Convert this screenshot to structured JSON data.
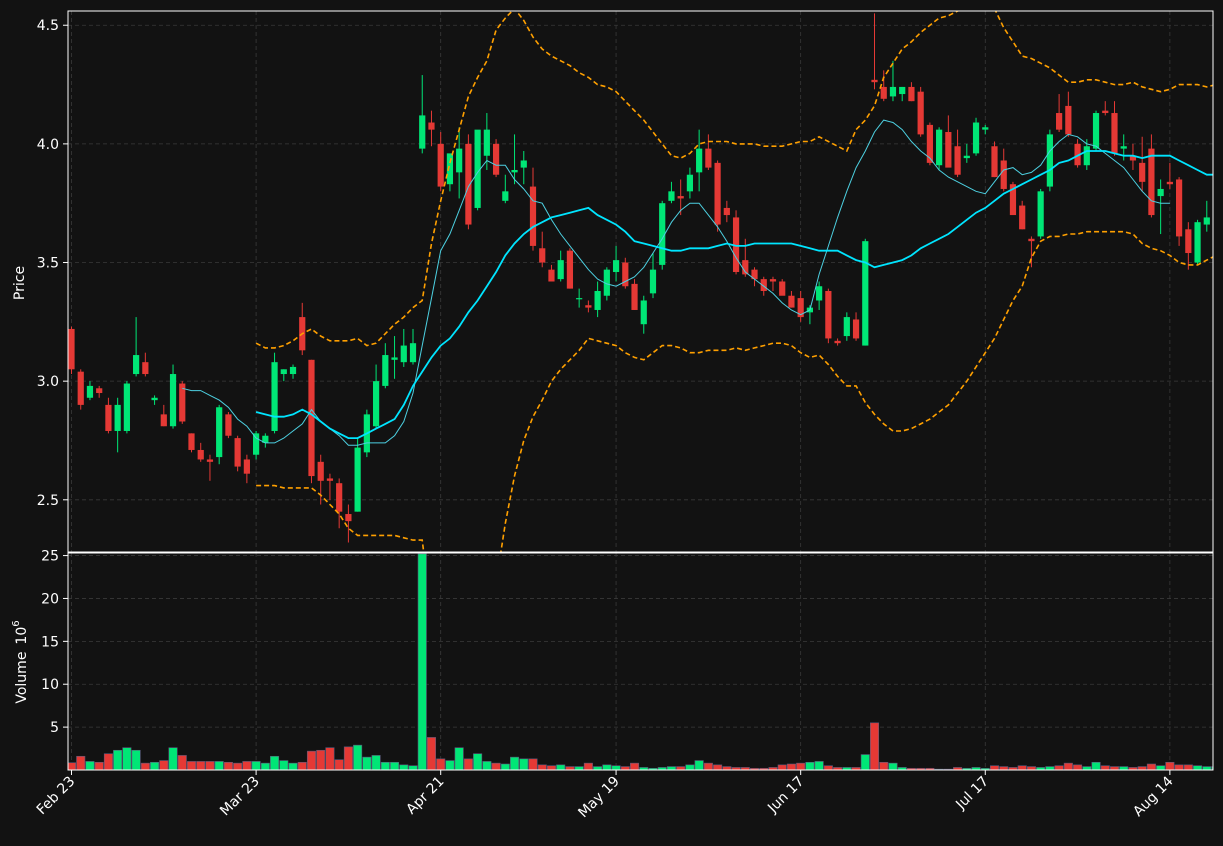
{
  "chart_data": {
    "type": "candlestick",
    "price_axis": {
      "label": "Price",
      "ylim": [
        2.28,
        4.56
      ],
      "ticks": [
        2.5,
        3.0,
        3.5,
        4.0,
        4.5
      ],
      "tick_labels": [
        "2.5",
        "3.0",
        "3.5",
        "4.0",
        "4.5"
      ]
    },
    "volume_axis": {
      "label": "Volume",
      "exponent_label": "10",
      "exponent": "6",
      "ylim": [
        0,
        25.3
      ],
      "ticks": [
        5,
        10,
        15,
        20,
        25
      ],
      "tick_labels": [
        "5",
        "10",
        "15",
        "20",
        "25"
      ]
    },
    "x_ticks": [
      {
        "index": 0,
        "label": "Feb 23"
      },
      {
        "index": 20,
        "label": "Mar 23"
      },
      {
        "index": 40,
        "label": "Apr 21"
      },
      {
        "index": 59,
        "label": "May 19"
      },
      {
        "index": 79,
        "label": "Jun 17"
      },
      {
        "index": 99,
        "label": "Jul 17"
      },
      {
        "index": 119,
        "label": "Aug 14"
      }
    ],
    "grid": true,
    "colors": {
      "up": "#00e676",
      "down": "#e53935",
      "background": "#121212",
      "grid": "#3a3a3a",
      "ma_short": "#4dd0e1",
      "ma_long": "#00e5ff",
      "bollinger": "#ffa000",
      "text": "#ffffff"
    },
    "candles": [
      [
        3.22,
        3.23,
        3.03,
        3.05,
        0.85
      ],
      [
        3.04,
        3.05,
        2.88,
        2.9,
        1.6
      ],
      [
        2.93,
        3.0,
        2.92,
        2.98,
        1.0
      ],
      [
        2.97,
        2.98,
        2.93,
        2.95,
        0.9
      ],
      [
        2.9,
        2.93,
        2.78,
        2.79,
        1.9
      ],
      [
        2.79,
        2.93,
        2.7,
        2.9,
        2.3
      ],
      [
        2.79,
        3.0,
        2.78,
        2.99,
        2.6
      ],
      [
        3.03,
        3.27,
        3.02,
        3.11,
        2.3
      ],
      [
        3.08,
        3.12,
        3.02,
        3.03,
        0.8
      ],
      [
        2.92,
        2.94,
        2.9,
        2.93,
        0.9
      ],
      [
        2.86,
        2.9,
        2.81,
        2.81,
        1.1
      ],
      [
        2.81,
        3.07,
        2.8,
        3.03,
        2.6
      ],
      [
        2.99,
        3.0,
        2.82,
        2.83,
        1.7
      ],
      [
        2.78,
        2.78,
        2.7,
        2.71,
        1.0
      ],
      [
        2.71,
        2.74,
        2.66,
        2.67,
        1.0
      ],
      [
        2.67,
        2.69,
        2.58,
        2.66,
        1.0
      ],
      [
        2.68,
        2.9,
        2.65,
        2.89,
        1.0
      ],
      [
        2.86,
        2.87,
        2.76,
        2.77,
        0.9
      ],
      [
        2.76,
        2.77,
        2.62,
        2.64,
        0.8
      ],
      [
        2.67,
        2.69,
        2.57,
        2.61,
        1.0
      ],
      [
        2.69,
        2.79,
        2.67,
        2.78,
        1.0
      ],
      [
        2.74,
        2.78,
        2.72,
        2.77,
        0.8
      ],
      [
        2.79,
        3.12,
        2.78,
        3.08,
        1.6
      ],
      [
        3.03,
        3.05,
        3.0,
        3.05,
        1.1
      ],
      [
        3.03,
        3.07,
        3.01,
        3.06,
        0.8
      ],
      [
        3.27,
        3.33,
        3.11,
        3.13,
        0.9
      ],
      [
        3.09,
        3.09,
        2.57,
        2.6,
        2.2
      ],
      [
        2.66,
        2.69,
        2.48,
        2.58,
        2.3
      ],
      [
        2.59,
        2.61,
        2.5,
        2.58,
        2.6
      ],
      [
        2.57,
        2.59,
        2.38,
        2.45,
        1.2
      ],
      [
        2.44,
        2.48,
        2.32,
        2.41,
        2.7
      ],
      [
        2.45,
        2.76,
        2.45,
        2.72,
        2.9
      ],
      [
        2.7,
        2.88,
        2.68,
        2.86,
        1.5
      ],
      [
        2.81,
        3.07,
        2.8,
        3.0,
        1.7
      ],
      [
        2.98,
        3.16,
        2.97,
        3.11,
        0.9
      ],
      [
        3.09,
        3.19,
        3.01,
        3.1,
        0.9
      ],
      [
        3.08,
        3.22,
        3.06,
        3.15,
        0.6
      ],
      [
        3.08,
        3.22,
        3.07,
        3.16,
        0.5
      ],
      [
        3.98,
        4.29,
        3.96,
        4.12,
        25.2
      ],
      [
        4.09,
        4.14,
        3.99,
        4.06,
        3.8
      ],
      [
        4.0,
        4.05,
        3.8,
        3.82,
        1.3
      ],
      [
        3.83,
        3.92,
        3.8,
        3.96,
        1.1
      ],
      [
        3.88,
        4.07,
        3.77,
        3.98,
        2.6
      ],
      [
        4.0,
        4.04,
        3.64,
        3.66,
        1.3
      ],
      [
        3.73,
        3.98,
        3.72,
        4.06,
        1.9
      ],
      [
        3.95,
        4.13,
        3.89,
        4.06,
        1.0
      ],
      [
        4.0,
        4.02,
        3.86,
        3.87,
        0.8
      ],
      [
        3.76,
        3.87,
        3.75,
        3.8,
        0.7
      ],
      [
        3.88,
        4.04,
        3.83,
        3.89,
        1.5
      ],
      [
        3.9,
        3.97,
        3.83,
        3.93,
        1.3
      ],
      [
        3.82,
        3.9,
        3.55,
        3.57,
        1.3
      ],
      [
        3.56,
        3.63,
        3.48,
        3.5,
        0.6
      ],
      [
        3.47,
        3.49,
        3.42,
        3.42,
        0.5
      ],
      [
        3.43,
        3.55,
        3.42,
        3.51,
        0.6
      ],
      [
        3.55,
        3.56,
        3.39,
        3.39,
        0.4
      ],
      [
        3.35,
        3.39,
        3.31,
        3.35,
        0.4
      ],
      [
        3.32,
        3.34,
        3.29,
        3.31,
        0.8
      ],
      [
        3.3,
        3.42,
        3.27,
        3.38,
        0.4
      ],
      [
        3.36,
        3.48,
        3.34,
        3.47,
        0.6
      ],
      [
        3.46,
        3.57,
        3.42,
        3.51,
        0.5
      ],
      [
        3.5,
        3.52,
        3.39,
        3.4,
        0.4
      ],
      [
        3.41,
        3.43,
        3.3,
        3.3,
        0.8
      ],
      [
        3.24,
        3.36,
        3.2,
        3.34,
        0.3
      ],
      [
        3.37,
        3.54,
        3.35,
        3.47,
        0.2
      ],
      [
        3.49,
        3.76,
        3.47,
        3.75,
        0.3
      ],
      [
        3.76,
        3.84,
        3.75,
        3.8,
        0.4
      ],
      [
        3.78,
        3.85,
        3.7,
        3.77,
        0.4
      ],
      [
        3.8,
        3.9,
        3.77,
        3.87,
        0.6
      ],
      [
        3.88,
        4.06,
        3.8,
        3.98,
        1.1
      ],
      [
        3.98,
        4.04,
        3.89,
        3.9,
        0.8
      ],
      [
        3.92,
        3.93,
        3.63,
        3.66,
        0.6
      ],
      [
        3.73,
        3.76,
        3.67,
        3.7,
        0.4
      ],
      [
        3.69,
        3.72,
        3.45,
        3.46,
        0.3
      ],
      [
        3.51,
        3.6,
        3.44,
        3.45,
        0.3
      ],
      [
        3.47,
        3.48,
        3.4,
        3.43,
        0.2
      ],
      [
        3.43,
        3.44,
        3.36,
        3.38,
        0.2
      ],
      [
        3.43,
        3.44,
        3.38,
        3.42,
        0.3
      ],
      [
        3.42,
        3.43,
        3.37,
        3.36,
        0.6
      ],
      [
        3.36,
        3.38,
        3.31,
        3.31,
        0.7
      ],
      [
        3.35,
        3.38,
        3.25,
        3.27,
        0.8
      ],
      [
        3.29,
        3.32,
        3.24,
        3.31,
        0.9
      ],
      [
        3.34,
        3.42,
        3.3,
        3.4,
        1.0
      ],
      [
        3.38,
        3.39,
        3.16,
        3.18,
        0.5
      ],
      [
        3.17,
        3.18,
        3.15,
        3.16,
        0.3
      ],
      [
        3.19,
        3.29,
        3.17,
        3.27,
        0.3
      ],
      [
        3.26,
        3.29,
        3.17,
        3.18,
        0.3
      ],
      [
        3.15,
        3.6,
        3.15,
        3.59,
        1.8
      ],
      [
        4.27,
        4.55,
        4.23,
        4.26,
        5.5
      ],
      [
        4.24,
        4.31,
        4.18,
        4.19,
        0.9
      ],
      [
        4.2,
        4.35,
        4.18,
        4.24,
        0.8
      ],
      [
        4.21,
        4.24,
        4.18,
        4.24,
        0.3
      ],
      [
        4.24,
        4.26,
        4.18,
        4.18,
        0.2
      ],
      [
        4.22,
        4.24,
        4.03,
        4.04,
        0.2
      ],
      [
        4.08,
        4.09,
        3.91,
        3.92,
        0.2
      ],
      [
        3.91,
        4.07,
        3.89,
        4.06,
        0.1
      ],
      [
        4.05,
        4.12,
        3.91,
        3.9,
        0.1
      ],
      [
        3.99,
        4.06,
        3.86,
        3.87,
        0.3
      ],
      [
        3.94,
        4.0,
        3.92,
        3.95,
        0.2
      ],
      [
        3.96,
        4.11,
        3.95,
        4.09,
        0.3
      ],
      [
        4.06,
        4.08,
        4.04,
        4.07,
        0.2
      ],
      [
        3.99,
        4.01,
        3.86,
        3.86,
        0.5
      ],
      [
        3.93,
        3.98,
        3.8,
        3.81,
        0.4
      ],
      [
        3.83,
        3.84,
        3.71,
        3.7,
        0.3
      ],
      [
        3.74,
        3.76,
        3.64,
        3.64,
        0.5
      ],
      [
        3.6,
        3.61,
        3.48,
        3.59,
        0.4
      ],
      [
        3.61,
        3.81,
        3.6,
        3.8,
        0.3
      ],
      [
        3.82,
        4.06,
        3.8,
        4.04,
        0.4
      ],
      [
        4.13,
        4.21,
        4.05,
        4.06,
        0.5
      ],
      [
        4.16,
        4.22,
        4.03,
        4.04,
        0.8
      ],
      [
        4.0,
        4.02,
        3.9,
        3.91,
        0.6
      ],
      [
        3.91,
        4.02,
        3.89,
        3.99,
        0.4
      ],
      [
        3.98,
        4.14,
        3.97,
        4.13,
        0.9
      ],
      [
        4.14,
        4.18,
        4.12,
        4.13,
        0.5
      ],
      [
        4.13,
        4.18,
        3.95,
        3.96,
        0.4
      ],
      [
        3.98,
        4.04,
        3.93,
        3.99,
        0.4
      ],
      [
        3.95,
        4.0,
        3.89,
        3.93,
        0.3
      ],
      [
        3.92,
        4.03,
        3.8,
        3.84,
        0.4
      ],
      [
        3.98,
        4.04,
        3.69,
        3.7,
        0.7
      ],
      [
        3.78,
        3.85,
        3.62,
        3.81,
        0.5
      ],
      [
        3.84,
        3.92,
        3.81,
        3.83,
        0.9
      ],
      [
        3.85,
        3.86,
        3.57,
        3.61,
        0.6
      ],
      [
        3.64,
        3.67,
        3.47,
        3.54,
        0.6
      ],
      [
        3.5,
        3.68,
        3.49,
        3.67,
        0.5
      ],
      [
        3.66,
        3.76,
        3.63,
        3.69,
        0.4
      ],
      [
        3.63,
        3.85,
        3.6,
        3.86,
        0.4
      ],
      [
        3.89,
        4.01,
        3.87,
        4.01,
        0.4
      ]
    ],
    "ma_short": [
      null,
      null,
      null,
      null,
      null,
      null,
      null,
      null,
      null,
      null,
      null,
      null,
      2.97,
      2.96,
      2.96,
      2.94,
      2.92,
      2.89,
      2.84,
      2.81,
      2.76,
      2.74,
      2.74,
      2.76,
      2.79,
      2.82,
      2.88,
      2.83,
      2.8,
      2.77,
      2.73,
      2.73,
      2.74,
      2.74,
      2.74,
      2.77,
      2.83,
      2.95,
      3.15,
      3.35,
      3.55,
      3.62,
      3.72,
      3.82,
      3.88,
      3.93,
      3.91,
      3.91,
      3.85,
      3.81,
      3.76,
      3.75,
      3.68,
      3.62,
      3.57,
      3.52,
      3.47,
      3.43,
      3.41,
      3.4,
      3.42,
      3.44,
      3.48,
      3.54,
      3.6,
      3.67,
      3.72,
      3.75,
      3.75,
      3.7,
      3.65,
      3.59,
      3.52,
      3.46,
      3.43,
      3.4,
      3.37,
      3.33,
      3.3,
      3.28,
      3.3,
      3.45,
      3.57,
      3.69,
      3.8,
      3.9,
      3.97,
      4.05,
      4.1,
      4.09,
      4.06,
      4.01,
      3.97,
      3.94,
      3.89,
      3.86,
      3.84,
      3.82,
      3.8,
      3.79,
      3.84,
      3.89,
      3.9,
      3.87,
      3.88,
      3.91,
      3.97,
      4.01,
      4.04,
      4.03,
      4.0,
      3.99,
      3.96,
      3.93,
      3.9,
      3.85,
      3.8,
      3.76,
      3.75,
      3.75,
      null,
      null
    ],
    "ma_long": [
      null,
      null,
      null,
      null,
      null,
      null,
      null,
      null,
      null,
      null,
      null,
      null,
      null,
      null,
      null,
      null,
      null,
      null,
      null,
      null,
      2.87,
      2.86,
      2.85,
      2.85,
      2.86,
      2.88,
      2.86,
      2.83,
      2.8,
      2.78,
      2.76,
      2.76,
      2.78,
      2.8,
      2.82,
      2.84,
      2.9,
      2.98,
      3.04,
      3.1,
      3.15,
      3.18,
      3.23,
      3.29,
      3.34,
      3.4,
      3.46,
      3.53,
      3.58,
      3.62,
      3.65,
      3.67,
      3.69,
      3.7,
      3.71,
      3.72,
      3.73,
      3.7,
      3.68,
      3.66,
      3.63,
      3.59,
      3.58,
      3.57,
      3.56,
      3.55,
      3.55,
      3.56,
      3.56,
      3.56,
      3.57,
      3.58,
      3.57,
      3.57,
      3.58,
      3.58,
      3.58,
      3.58,
      3.58,
      3.57,
      3.56,
      3.55,
      3.55,
      3.55,
      3.53,
      3.51,
      3.5,
      3.48,
      3.49,
      3.5,
      3.51,
      3.53,
      3.56,
      3.58,
      3.6,
      3.62,
      3.65,
      3.68,
      3.71,
      3.73,
      3.76,
      3.79,
      3.81,
      3.83,
      3.85,
      3.87,
      3.89,
      3.92,
      3.93,
      3.95,
      3.97,
      3.97,
      3.97,
      3.96,
      3.95,
      3.95,
      3.94,
      3.95,
      3.95,
      3.95,
      3.93,
      3.91,
      3.89,
      3.87,
      3.87,
      3.88,
      3.9
    ],
    "boll_upper": [
      null,
      null,
      null,
      null,
      null,
      null,
      null,
      null,
      null,
      null,
      null,
      null,
      null,
      null,
      null,
      null,
      null,
      null,
      null,
      null,
      3.16,
      3.14,
      3.14,
      3.15,
      3.17,
      3.2,
      3.22,
      3.19,
      3.17,
      3.17,
      3.17,
      3.18,
      3.15,
      3.16,
      3.2,
      3.24,
      3.27,
      3.31,
      3.34,
      3.58,
      3.76,
      3.92,
      4.06,
      4.2,
      4.28,
      4.35,
      4.48,
      4.53,
      4.57,
      4.52,
      4.45,
      4.4,
      4.37,
      4.35,
      4.33,
      4.3,
      4.28,
      4.25,
      4.24,
      4.22,
      4.18,
      4.14,
      4.1,
      4.05,
      4.0,
      3.95,
      3.94,
      3.96,
      4.0,
      4.01,
      4.01,
      4.01,
      4.0,
      4.0,
      4.0,
      3.99,
      3.99,
      3.99,
      4.0,
      4.01,
      4.01,
      4.03,
      4.01,
      3.99,
      3.97,
      4.06,
      4.1,
      4.16,
      4.28,
      4.34,
      4.4,
      4.43,
      4.47,
      4.5,
      4.53,
      4.54,
      4.56,
      4.57,
      4.6,
      4.62,
      4.57,
      4.49,
      4.43,
      4.37,
      4.36,
      4.34,
      4.32,
      4.29,
      4.26,
      4.26,
      4.27,
      4.27,
      4.26,
      4.25,
      4.25,
      4.26,
      4.24,
      4.23,
      4.22,
      4.23,
      4.25,
      4.25,
      4.25,
      4.24,
      4.25
    ],
    "boll_lower": [
      null,
      null,
      null,
      null,
      null,
      null,
      null,
      null,
      null,
      null,
      null,
      null,
      null,
      null,
      null,
      null,
      null,
      null,
      null,
      null,
      2.56,
      2.56,
      2.56,
      2.55,
      2.55,
      2.55,
      2.55,
      2.52,
      2.48,
      2.44,
      2.38,
      2.35,
      2.35,
      2.35,
      2.35,
      2.35,
      2.34,
      2.33,
      2.33,
      2.02,
      1.8,
      1.6,
      1.5,
      1.45,
      1.6,
      1.8,
      2.15,
      2.4,
      2.6,
      2.75,
      2.85,
      2.92,
      3.0,
      3.05,
      3.09,
      3.13,
      3.18,
      3.17,
      3.16,
      3.15,
      3.12,
      3.1,
      3.09,
      3.12,
      3.15,
      3.15,
      3.14,
      3.12,
      3.12,
      3.13,
      3.13,
      3.13,
      3.14,
      3.13,
      3.14,
      3.15,
      3.16,
      3.16,
      3.15,
      3.12,
      3.1,
      3.11,
      3.07,
      3.02,
      2.98,
      2.98,
      2.91,
      2.86,
      2.82,
      2.79,
      2.79,
      2.8,
      2.82,
      2.84,
      2.87,
      2.9,
      2.95,
      3.0,
      3.06,
      3.12,
      3.18,
      3.26,
      3.34,
      3.4,
      3.52,
      3.59,
      3.61,
      3.61,
      3.62,
      3.62,
      3.63,
      3.63,
      3.63,
      3.63,
      3.63,
      3.62,
      3.58,
      3.56,
      3.55,
      3.53,
      3.5,
      3.49,
      3.49,
      3.51,
      3.53,
      3.54
    ]
  }
}
